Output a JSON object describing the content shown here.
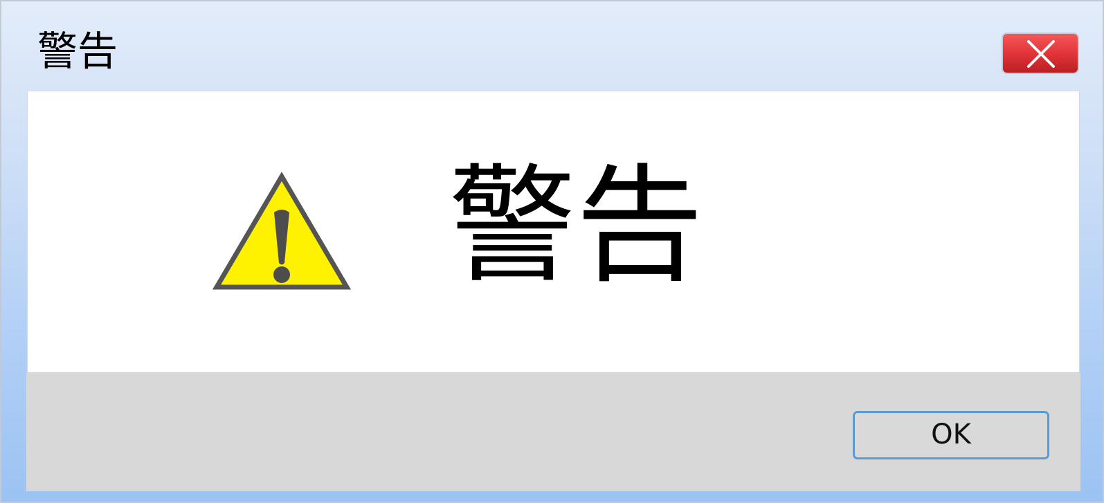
{
  "window": {
    "title": "警告",
    "close_icon": "close-x-icon",
    "close_button_color": "#e2353a"
  },
  "dialog": {
    "icon": "warning-triangle-icon",
    "icon_colors": {
      "fill": "#fff200",
      "stroke": "#555555",
      "mark": "#4d4d4d"
    },
    "message": "警告"
  },
  "footer": {
    "ok_label": "OK",
    "ok_border_color": "#5b9bd5"
  }
}
